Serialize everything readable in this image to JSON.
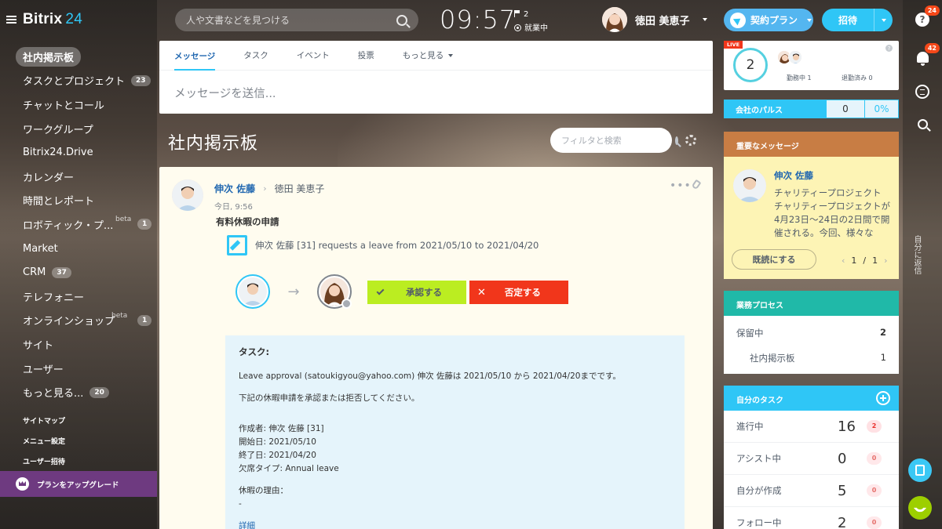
{
  "header": {
    "logo": "Bitrix",
    "logo_num": "24",
    "search_placeholder": "人や文書などを見つける",
    "clock": "09:57",
    "flag_count": "2",
    "work_status": "就業中",
    "user_name": "徳田 美恵子",
    "plan_label": "契約プラン",
    "invite_label": "招待"
  },
  "rail": {
    "help_badge": "24",
    "notif_badge": "42",
    "vertical_text": "自分に返信"
  },
  "menu": {
    "items": [
      {
        "label": "社内掲示板"
      },
      {
        "label": "タスクとプロジェクト",
        "count": "23"
      },
      {
        "label": "チャットとコール"
      },
      {
        "label": "ワークグループ"
      },
      {
        "label": "Bitrix24.Drive"
      },
      {
        "label": "カレンダー"
      },
      {
        "label": "時間とレポート"
      },
      {
        "label": "ロボティック・プ...",
        "beta": "beta",
        "count": "1"
      },
      {
        "label": "Market"
      },
      {
        "label": "CRM",
        "count": "37"
      },
      {
        "label": "テレフォニー"
      },
      {
        "label": "オンラインショップ",
        "beta": "beta",
        "count": "1"
      },
      {
        "label": "サイト"
      },
      {
        "label": "ユーザー"
      },
      {
        "label": "もっと見る...",
        "count": "20"
      }
    ],
    "sitemap": "サイトマップ",
    "menu_settings": "メニュー設定",
    "invite_users": "ユーザー招待",
    "upgrade": "プランをアップグレード"
  },
  "composer": {
    "tabs": [
      "メッセージ",
      "タスク",
      "イベント",
      "投票",
      "もっと見る"
    ],
    "placeholder": "メッセージを送信..."
  },
  "page": {
    "title": "社内掲示板",
    "filter_placeholder": "フィルタと検索"
  },
  "post": {
    "author": "伸次 佐藤",
    "recipient": "徳田 美恵子",
    "time": "今日, 9:56",
    "title": "有料休暇の申請",
    "request": "伸次 佐藤 [31] requests a leave from 2021/05/10 to 2021/04/20",
    "approve": "承認する",
    "reject": "否定する",
    "task_heading": "タスク:",
    "task_line1": "Leave approval (satoukigyou@yahoo.com) 伸次 佐藤は 2021/05/10 から 2021/04/20までです。",
    "task_line2": "下記の休暇申請を承認または拒否してください。",
    "creator": "作成者: 伸次 佐藤 [31]",
    "start": "開始日: 2021/05/10",
    "end": "終了日: 2021/04/20",
    "absence": "欠席タイプ: Annual leave",
    "reason_label": "休暇の理由：",
    "reason_value": "-",
    "details": "詳細"
  },
  "widgets": {
    "live": {
      "badge": "LIVE",
      "count": "2",
      "working_label": "勤務中",
      "working_count": "1",
      "left_label": "退勤済み",
      "left_count": "0"
    },
    "pulse": {
      "label": "会社のパルス",
      "value": "0",
      "percent": "0%"
    },
    "important": {
      "title": "重要なメッセージ",
      "author": "伸次 佐藤",
      "text": "チャリティープロジェクト チャリティープロジェクトが4月23日〜24日の2日間で開催される。今回、様々な",
      "read_button": "既読にする",
      "page": "1",
      "of": "/",
      "total": "1"
    },
    "business": {
      "title": "業務プロセス",
      "rows": [
        {
          "label": "保留中",
          "value": "2"
        },
        {
          "label": "社内掲示板",
          "value": "1"
        }
      ]
    },
    "my_tasks": {
      "title": "自分のタスク",
      "rows": [
        {
          "label": "進行中",
          "num": "16",
          "badge": "2"
        },
        {
          "label": "アシスト中",
          "num": "0",
          "badge": "0"
        },
        {
          "label": "自分が作成",
          "num": "5",
          "badge": "0"
        },
        {
          "label": "フォロー中",
          "num": "2",
          "badge": "0"
        }
      ]
    }
  }
}
